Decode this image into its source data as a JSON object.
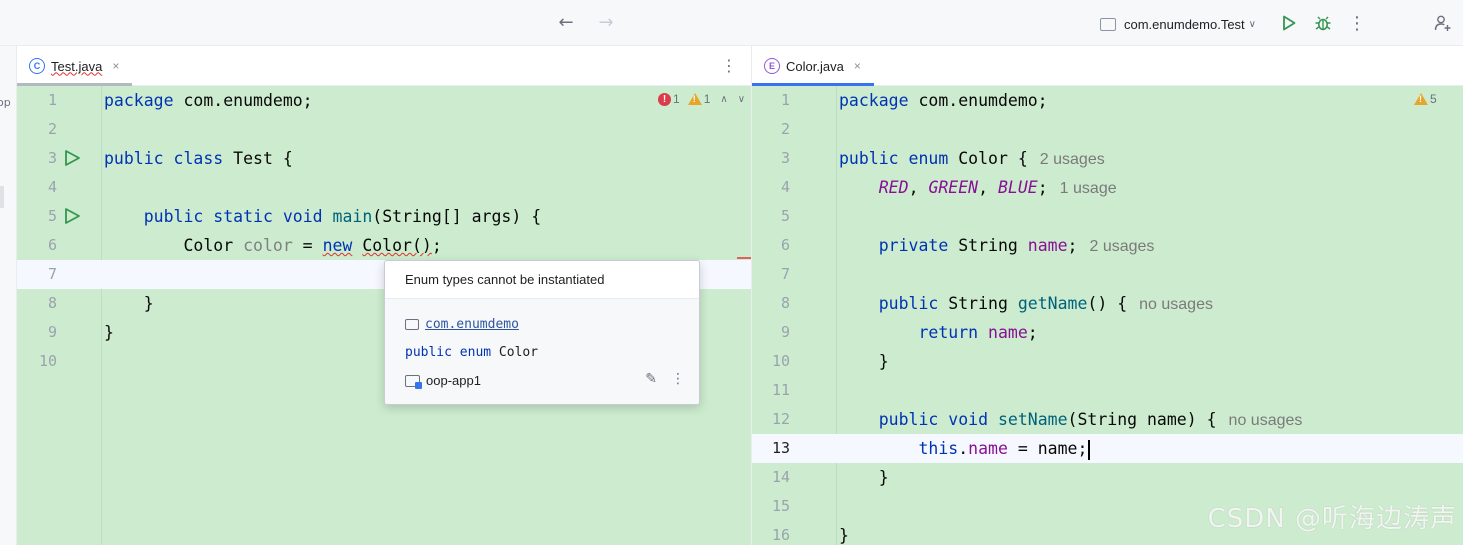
{
  "toolbar": {
    "back_icon": "arrow-left-icon",
    "forward_icon": "arrow-right-icon",
    "run_config": "com.enumdemo.Test",
    "more": "⋮"
  },
  "left_strip": {
    "label": "op"
  },
  "left_pane": {
    "tab": {
      "name": "Test.java",
      "close": "×"
    },
    "inspections": {
      "errors": "1",
      "warnings": "1"
    },
    "lines": [
      {
        "num": "1",
        "text": "package com.enumdemo;"
      },
      {
        "num": "2",
        "text": ""
      },
      {
        "num": "3",
        "text": "public class Test {"
      },
      {
        "num": "4",
        "text": ""
      },
      {
        "num": "5",
        "text": "    public static void main(String[] args) {"
      },
      {
        "num": "6",
        "text": "        Color color = new Color();"
      },
      {
        "num": "7",
        "text": ""
      },
      {
        "num": "8",
        "text": "    }"
      },
      {
        "num": "9",
        "text": "}"
      },
      {
        "num": "10",
        "text": ""
      }
    ]
  },
  "right_pane": {
    "tab": {
      "name": "Color.java",
      "close": "×"
    },
    "inspections": {
      "warnings": "5"
    },
    "lines": [
      {
        "num": "1",
        "text": "package com.enumdemo;"
      },
      {
        "num": "2",
        "text": ""
      },
      {
        "num": "3",
        "text": "public enum Color {",
        "hint": "2 usages"
      },
      {
        "num": "4",
        "text": "    RED, GREEN, BLUE;",
        "hint": "1 usage"
      },
      {
        "num": "5",
        "text": ""
      },
      {
        "num": "6",
        "text": "    private String name;",
        "hint": "2 usages"
      },
      {
        "num": "7",
        "text": ""
      },
      {
        "num": "8",
        "text": "    public String getName() {",
        "hint": "no usages"
      },
      {
        "num": "9",
        "text": "        return name;"
      },
      {
        "num": "10",
        "text": "    }"
      },
      {
        "num": "11",
        "text": ""
      },
      {
        "num": "12",
        "text": "    public void setName(String name) {",
        "hint": "no usages"
      },
      {
        "num": "13",
        "text": "        this.name = name;"
      },
      {
        "num": "14",
        "text": "    }"
      },
      {
        "num": "15",
        "text": ""
      },
      {
        "num": "16",
        "text": "}"
      }
    ]
  },
  "popup": {
    "message": "Enum types cannot be instantiated",
    "package": "com.enumdemo",
    "declaration": "public enum Color",
    "module": "oop-app1"
  },
  "watermark": "CSDN @听海边涛声",
  "colors": {
    "editor_bg": "#cdeccf",
    "keyword": "#0033b3",
    "field": "#871094",
    "accent": "#3574f0"
  }
}
